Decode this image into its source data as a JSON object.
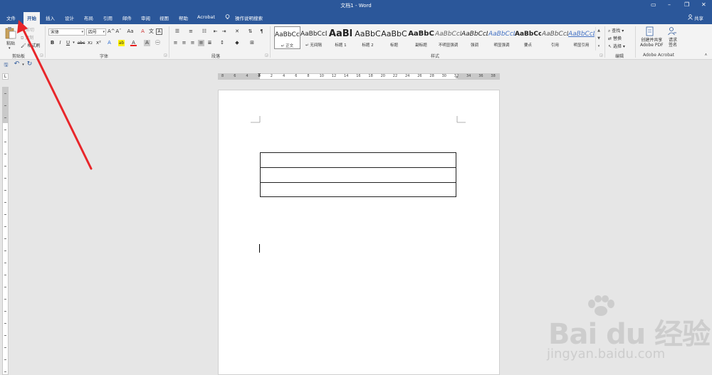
{
  "titlebar": {
    "title": "文档1 - Word",
    "share": "共享"
  },
  "tabs": [
    "文件",
    "开始",
    "插入",
    "设计",
    "布局",
    "引用",
    "邮件",
    "审阅",
    "视图",
    "帮助",
    "Acrobat"
  ],
  "tell_me": "操作说明搜索",
  "clipboard": {
    "paste": "粘贴",
    "cut": "剪切",
    "copy": "复制",
    "format_painter": "格式刷",
    "label": "剪贴板"
  },
  "font": {
    "name": "宋体",
    "size": "四号",
    "label": "字体",
    "bold": "B",
    "italic": "I",
    "underline": "U",
    "strike": "abc",
    "sub": "x₂",
    "sup": "x²",
    "grow": "A^",
    "shrink": "Aˇ",
    "case": "Aa",
    "clear": "A",
    "char_border": "A",
    "font_color": "A",
    "highlight": "ab"
  },
  "paragraph": {
    "label": "段落"
  },
  "styles": {
    "label": "样式",
    "items": [
      {
        "preview": "AaBbCcDd",
        "name": "↵ 正文"
      },
      {
        "preview": "AaBbCcDd",
        "name": "↵ 无间隔"
      },
      {
        "preview": "AaBl",
        "name": "标题 1"
      },
      {
        "preview": "AaBbC",
        "name": "标题 2"
      },
      {
        "preview": "AaBbC",
        "name": "标题"
      },
      {
        "preview": "AaBbC",
        "name": "副标题"
      },
      {
        "preview": "AaBbCcDd",
        "name": "不明显强调"
      },
      {
        "preview": "AaBbCcDd",
        "name": "强调"
      },
      {
        "preview": "AaBbCcDd",
        "name": "明显强调"
      },
      {
        "preview": "AaBbCcDd",
        "name": "要点"
      },
      {
        "preview": "AaBbCcDd",
        "name": "引用"
      },
      {
        "preview": "AaBbCcDd",
        "name": "明显引用"
      }
    ]
  },
  "editing": {
    "find": "查找",
    "replace": "替换",
    "select": "选择",
    "label": "编辑"
  },
  "acrobat": {
    "create_pdf_line1": "创建并共享",
    "create_pdf_line2": "Adobe PDF",
    "request_line1": "请求",
    "request_line2": "签名",
    "label": "Adobe Acrobat"
  },
  "ruler_marks": [
    "8",
    "6",
    "4",
    "2",
    "2",
    "4",
    "6",
    "8",
    "10",
    "12",
    "14",
    "16",
    "18",
    "20",
    "22",
    "24",
    "26",
    "28",
    "30",
    "32",
    "34",
    "36",
    "38"
  ],
  "document": {
    "table_rows": 3
  },
  "watermark": {
    "brand": "Bai du 经验",
    "url": "jingyan.baidu.com"
  },
  "colors": {
    "accent": "#2b579a",
    "arrow": "#e8262a",
    "font_red": "#e81c1c",
    "highlight_yellow": "#fff200"
  }
}
